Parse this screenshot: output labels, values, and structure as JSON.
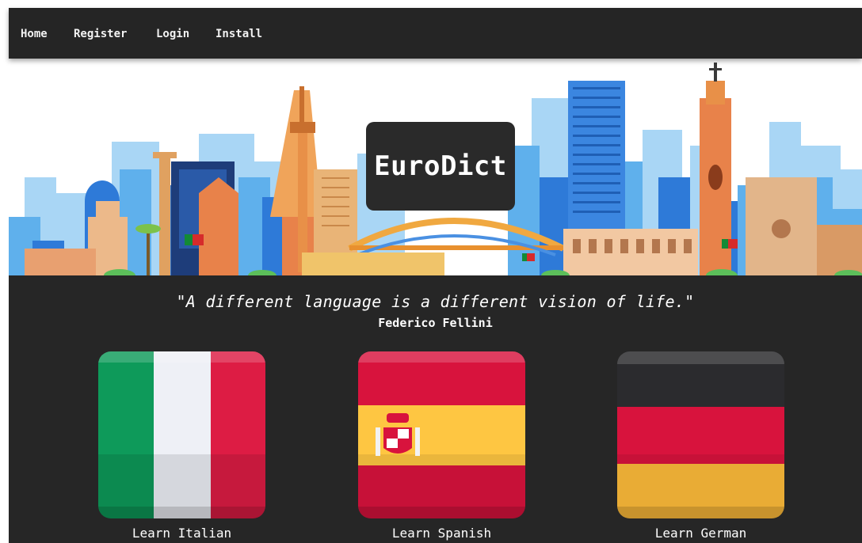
{
  "nav": {
    "items": [
      {
        "label": "Home"
      },
      {
        "label": "Register"
      },
      {
        "label": "Login"
      },
      {
        "label": "Install"
      }
    ]
  },
  "hero": {
    "brand": "EuroDict"
  },
  "quote": {
    "text": "\"A different language is a different vision of life.\"",
    "author": "Federico Fellini"
  },
  "languages": [
    {
      "label": "Learn Italian",
      "flag": "italy-flag-icon"
    },
    {
      "label": "Learn Spanish",
      "flag": "spain-flag-icon"
    },
    {
      "label": "Learn German",
      "flag": "germany-flag-icon"
    }
  ],
  "colors": {
    "nav_bg": "#252525",
    "main_bg": "#262626",
    "logo_bg": "#2a2a2a"
  }
}
